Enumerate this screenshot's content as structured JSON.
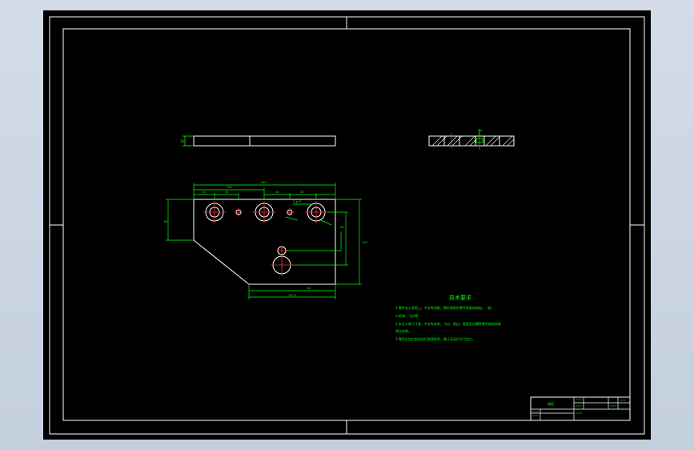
{
  "drawing": {
    "tech_title": "技术要求",
    "tech_notes": [
      "1.零件加工表面上，不应有划痕、擦伤等损伤零件表面的缺陷。（缺",
      "少毛刺、飞边等）",
      "2.未注公差尺寸按，不应有毛刺、飞边、锐边，表面无沟槽等零件缺陷现象",
      "除去毛刺。",
      "3.零件在加工前应进行划线检验，确认无误后方可加工。"
    ],
    "dims": {
      "overall_width": "160",
      "width_180": "180",
      "d20": "20",
      "d55": "55",
      "d40": "40",
      "holes": "3-φ12",
      "d45": "45",
      "h60": "60",
      "h100": "100",
      "h35": "35",
      "w82": "82",
      "bottom": "107.5",
      "thickness": "10"
    },
    "title_block": {
      "part_name": "底板",
      "scale": "1:1"
    }
  }
}
